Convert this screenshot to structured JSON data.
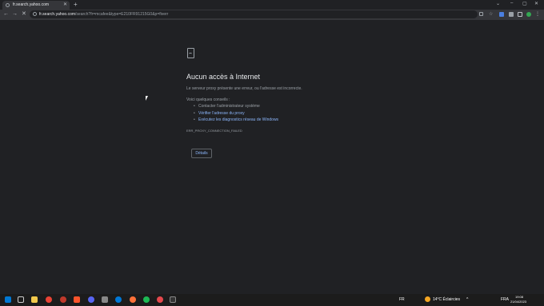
{
  "tab": {
    "title": "fr.search.yahoo.com",
    "close": "✕",
    "new_tab": "+"
  },
  "window": {
    "dropdown": "⌄",
    "minimize": "–",
    "maximize": "▢",
    "close": "✕"
  },
  "toolbar": {
    "back": "←",
    "forward": "→",
    "stop": "✕",
    "url_host": "fr.search.yahoo.com",
    "url_rest": "/search?fr=mcafee&type=E210FR91215G0&p=fiverr"
  },
  "error": {
    "icon": "sad-page-icon",
    "title": "Aucun accès à Internet",
    "description": "Le serveur proxy présente une erreur, ou l'adresse est incorrecte.",
    "suggestions_intro": "Voici quelques conseils :",
    "suggestions": [
      {
        "text": "Contacter l'administrateur système",
        "link": false
      },
      {
        "text": "Vérifier l'adresse du proxy",
        "link": true
      },
      {
        "text": "Exécutez les diagnostics réseau de Windows",
        "link": true
      }
    ],
    "code": "ERR_PROXY_CONNECTION_FAILED",
    "details_button": "Détails"
  },
  "taskbar": {
    "weather": "14°C  Éclaircies",
    "lang": "FRA",
    "time": "19:08",
    "date": "21/04/2023",
    "fr": "FR"
  },
  "colors": {
    "link": "#8ab4f8",
    "text": "#e8eaed",
    "muted": "#9aa0a6"
  }
}
